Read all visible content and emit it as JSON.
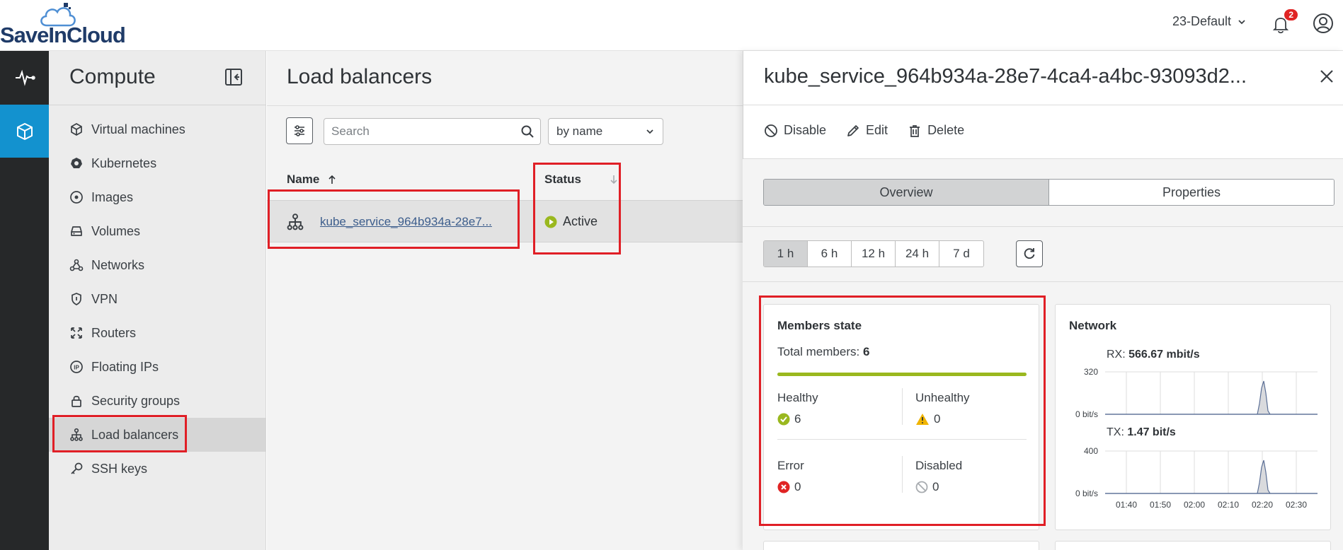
{
  "brand": {
    "name": "SaveInCloud"
  },
  "header": {
    "project": "23-Default",
    "notifications_count": "2"
  },
  "rail": [
    {
      "icon": "activity-icon",
      "active": false
    },
    {
      "icon": "compute-cube-icon",
      "active": true
    }
  ],
  "sidebar": {
    "title": "Compute",
    "items": [
      {
        "label": "Virtual machines",
        "icon": "cube-icon"
      },
      {
        "label": "Kubernetes",
        "icon": "kubernetes-icon"
      },
      {
        "label": "Images",
        "icon": "disc-icon"
      },
      {
        "label": "Volumes",
        "icon": "drive-icon"
      },
      {
        "label": "Networks",
        "icon": "network-icon"
      },
      {
        "label": "VPN",
        "icon": "shield-icon"
      },
      {
        "label": "Routers",
        "icon": "router-icon"
      },
      {
        "label": "Floating IPs",
        "icon": "ip-icon"
      },
      {
        "label": "Security groups",
        "icon": "lock-icon"
      },
      {
        "label": "Load balancers",
        "icon": "load-balancer-icon",
        "active": true
      },
      {
        "label": "SSH keys",
        "icon": "key-icon"
      }
    ]
  },
  "list": {
    "title": "Load balancers",
    "search_placeholder": "Search",
    "sort_value": "by name",
    "columns": {
      "name": "Name",
      "status": "Status"
    },
    "rows": [
      {
        "name": "kube_service_964b934a-28e7...",
        "status": "Active"
      }
    ]
  },
  "detail": {
    "title": "kube_service_964b934a-28e7-4ca4-a4bc-93093d2...",
    "actions": {
      "disable": "Disable",
      "edit": "Edit",
      "delete": "Delete"
    },
    "tabs": [
      "Overview",
      "Properties"
    ],
    "active_tab": "Overview",
    "ranges": [
      "1 h",
      "6 h",
      "12 h",
      "24 h",
      "7 d"
    ],
    "active_range": "1 h",
    "members": {
      "title": "Members state",
      "total_label": "Total members:",
      "total_value": "6",
      "healthy_fraction": 1.0,
      "healthy_label": "Healthy",
      "healthy_value": "6",
      "unhealthy_label": "Unhealthy",
      "unhealthy_value": "0",
      "error_label": "Error",
      "error_value": "0",
      "disabled_label": "Disabled",
      "disabled_value": "0"
    },
    "network": {
      "title": "Network",
      "rx_label": "RX:",
      "rx_value": "566.67 mbit/s",
      "tx_label": "TX:",
      "tx_value": "1.47 bit/s",
      "rx_ymax": "320",
      "rx_ymin": "0 bit/s",
      "tx_ymax": "400",
      "tx_ymin": "0 bit/s",
      "x_ticks": [
        "01:40",
        "01:50",
        "02:00",
        "02:10",
        "02:20",
        "02:30"
      ]
    }
  },
  "colors": {
    "accent": "#1392cf",
    "rail": "#262829",
    "highlight": "#e01f26",
    "active_green": "#9ab81f",
    "warning": "#f0b400",
    "error": "#e02424"
  }
}
